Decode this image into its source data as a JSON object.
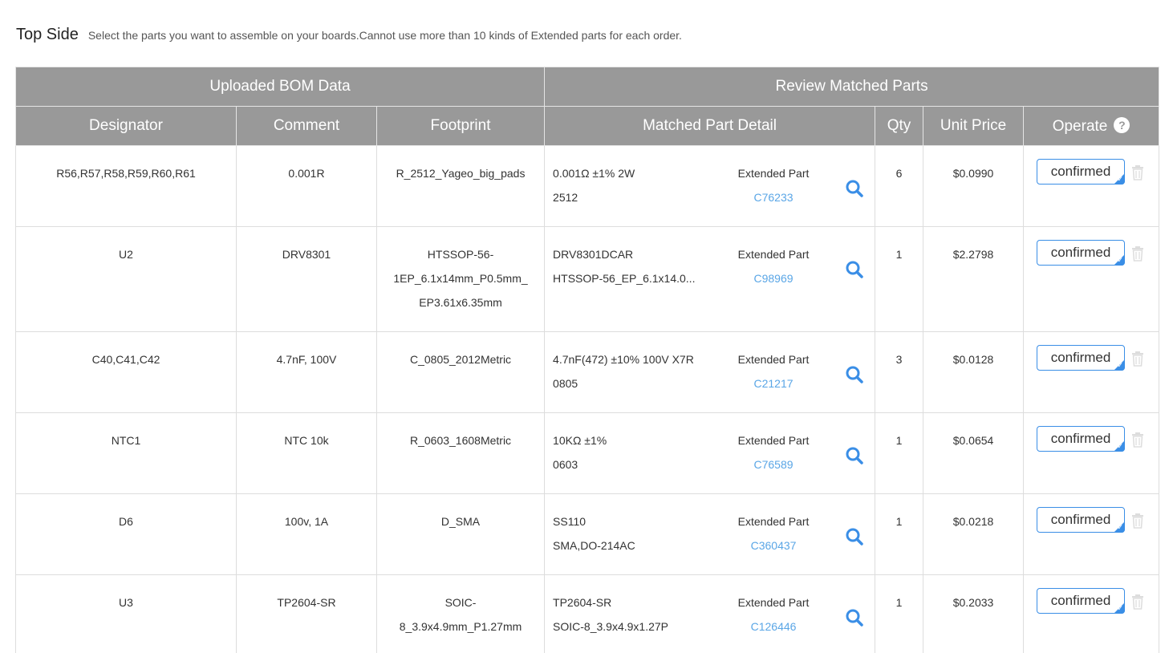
{
  "header": {
    "title": "Top Side",
    "subtitle": "Select the parts you want to assemble on your boards.Cannot use more than 10 kinds of Extended parts for each order."
  },
  "table": {
    "groups": [
      "Uploaded BOM Data",
      "Review Matched Parts"
    ],
    "columns": {
      "designator": "Designator",
      "comment": "Comment",
      "footprint": "Footprint",
      "matched": "Matched Part Detail",
      "qty": "Qty",
      "unit_price": "Unit Price",
      "operate": "Operate"
    },
    "rows": [
      {
        "designator": "R56,R57,R58,R59,R60,R61",
        "comment": "0.001R",
        "footprint": [
          "R_2512_Yageo_big_pads"
        ],
        "desc1": "0.001Ω ±1% 2W",
        "desc2": "2512",
        "type": "Extended Part",
        "code": "C76233",
        "qty": "6",
        "price": "$0.0990",
        "status": "confirmed"
      },
      {
        "designator": "U2",
        "comment": "DRV8301",
        "footprint": [
          "HTSSOP-56-",
          "1EP_6.1x14mm_P0.5mm_",
          "EP3.61x6.35mm"
        ],
        "desc1": "DRV8301DCAR",
        "desc2": "HTSSOP-56_EP_6.1x14.0...",
        "type": "Extended Part",
        "code": "C98969",
        "qty": "1",
        "price": "$2.2798",
        "status": "confirmed"
      },
      {
        "designator": "C40,C41,C42",
        "comment": "4.7nF, 100V",
        "footprint": [
          "C_0805_2012Metric"
        ],
        "desc1": "4.7nF(472) ±10% 100V X7R",
        "desc2": "0805",
        "type": "Extended Part",
        "code": "C21217",
        "qty": "3",
        "price": "$0.0128",
        "status": "confirmed"
      },
      {
        "designator": "NTC1",
        "comment": "NTC 10k",
        "footprint": [
          "R_0603_1608Metric"
        ],
        "desc1": "10KΩ ±1%",
        "desc2": "0603",
        "type": "Extended Part",
        "code": "C76589",
        "qty": "1",
        "price": "$0.0654",
        "status": "confirmed"
      },
      {
        "designator": "D6",
        "comment": "100v, 1A",
        "footprint": [
          "D_SMA"
        ],
        "desc1": "SS110",
        "desc2": "SMA,DO-214AC",
        "type": "Extended Part",
        "code": "C360437",
        "qty": "1",
        "price": "$0.0218",
        "status": "confirmed"
      },
      {
        "designator": "U3",
        "comment": "TP2604-SR",
        "footprint": [
          "SOIC-",
          "8_3.9x4.9mm_P1.27mm"
        ],
        "desc1": "TP2604-SR",
        "desc2": "SOIC-8_3.9x4.9x1.27P",
        "type": "Extended Part",
        "code": "C126446",
        "qty": "1",
        "price": "$0.2033",
        "status": "confirmed"
      }
    ]
  },
  "colors": {
    "header_bg": "#999999",
    "link": "#5aa6e6",
    "accent": "#3a8ee6",
    "search_icon": "#3a8ee6"
  },
  "icons": {
    "search": "magnifier-icon",
    "help": "question-circle-icon",
    "delete": "trash-icon"
  }
}
